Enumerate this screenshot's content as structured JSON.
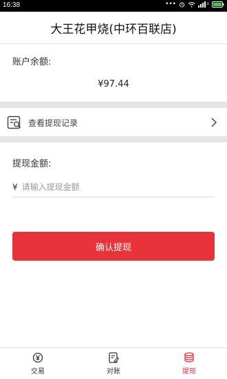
{
  "status_bar": {
    "time": "16:38",
    "icons": [
      "more-dots-icon",
      "alarm-icon",
      "wifi-icon",
      "signal-icon",
      "battery-icon"
    ]
  },
  "header": {
    "title": "大王花甲烧(中环百联店)"
  },
  "balance": {
    "label": "账户余额:",
    "value": "¥97.44"
  },
  "records": {
    "icon": "record-search-icon",
    "label": "查看提现记录"
  },
  "withdraw": {
    "label": "提现金额:",
    "currency": "¥",
    "placeholder": "请输入提现金额",
    "value": ""
  },
  "confirm": {
    "label": "确认提现"
  },
  "tabs": [
    {
      "label": "交易",
      "icon": "yuan-coin-icon",
      "active": false
    },
    {
      "label": "对账",
      "icon": "edit-list-icon",
      "active": false
    },
    {
      "label": "提现",
      "icon": "coin-stack-icon",
      "active": true
    }
  ],
  "colors": {
    "accent": "#e8333a",
    "divider": "#e5e5e5"
  }
}
